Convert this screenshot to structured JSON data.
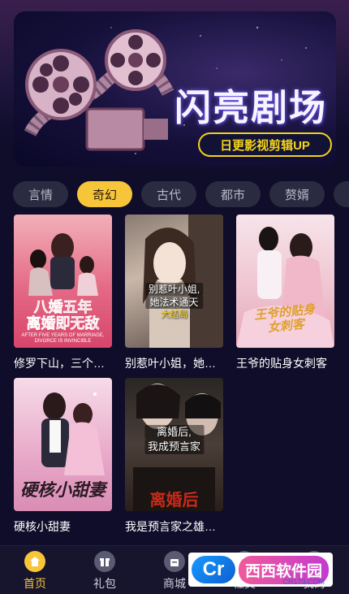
{
  "banner": {
    "title": "闪亮剧场",
    "subtitle": "日更影视剪辑UP"
  },
  "tabs": [
    {
      "label": "言情",
      "active": false
    },
    {
      "label": "奇幻",
      "active": true
    },
    {
      "label": "古代",
      "active": false
    },
    {
      "label": "都市",
      "active": false
    },
    {
      "label": "赘婿",
      "active": false
    }
  ],
  "dramas": [
    {
      "title": "修罗下山，三个…",
      "poster_text": [
        "八婚五年",
        "离婚即无敌"
      ],
      "poster_caption": "AFTER FIVE YEARS OF MARRIAGE, DIVORCE IS INVINCIBLE"
    },
    {
      "title": "别惹叶小姐，她…",
      "poster_caption": [
        "别惹叶小姐,",
        "她法术通天"
      ],
      "poster_badge": "大结局"
    },
    {
      "title": "王爷的贴身女刺客",
      "poster_text": [
        "王爷的贴身",
        "女刺客"
      ]
    },
    {
      "title": "硬核小甜妻",
      "poster_text": [
        "硬核小甜妻"
      ]
    },
    {
      "title": "我是预言家之雄…",
      "poster_caption": [
        "离婚后,",
        "我成预言家"
      ],
      "poster_text": [
        "离婚后"
      ]
    }
  ],
  "nav": [
    {
      "label": "首页",
      "icon": "home-icon",
      "active": true
    },
    {
      "label": "礼包",
      "icon": "gift-icon",
      "active": false
    },
    {
      "label": "商城",
      "icon": "shop-icon",
      "active": false
    },
    {
      "label": "社交",
      "icon": "social-icon",
      "active": false
    },
    {
      "label": "我的",
      "icon": "profile-icon",
      "active": false
    }
  ],
  "watermark": {
    "logo": "Cr",
    "brand": "西西软件园",
    "url": "CR173.COM"
  },
  "colors": {
    "background": "#0f0d2a",
    "accent": "#f6c53a",
    "tab_bg": "#2a2a40"
  }
}
